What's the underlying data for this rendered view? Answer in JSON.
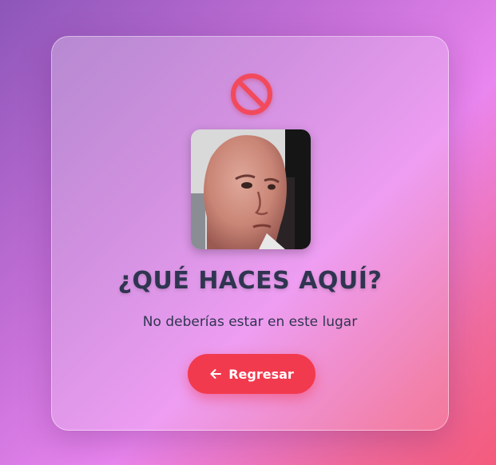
{
  "card": {
    "title": "¿QUÉ HACES AQUÍ?",
    "subtitle": "No deberías estar en este lugar",
    "back_button_label": "Regresar"
  },
  "icons": {
    "top": "ban-icon",
    "button": "arrow-left-icon"
  },
  "colors": {
    "accent": "#f23a4e",
    "ban": "#f24a5c",
    "text": "#2f3550"
  }
}
